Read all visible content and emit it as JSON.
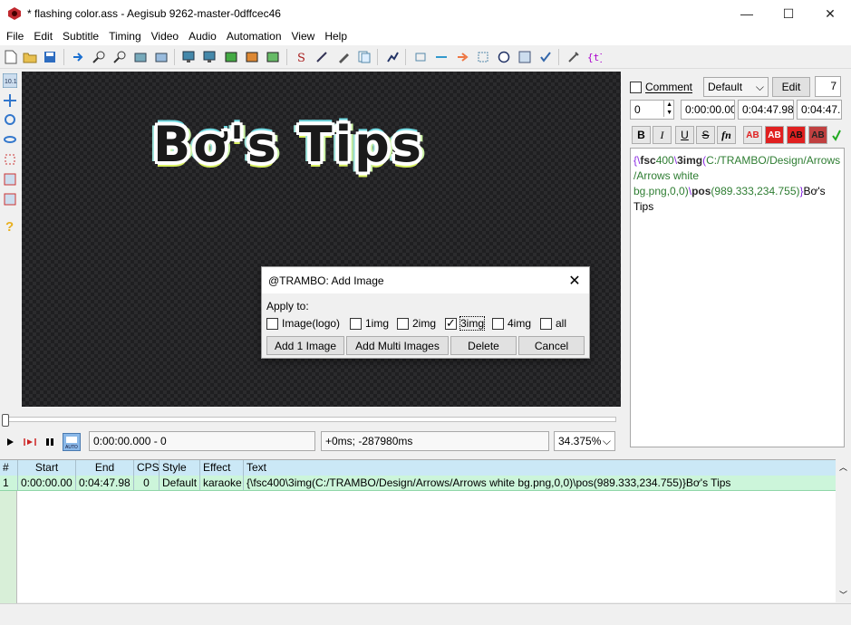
{
  "window": {
    "title": "* flashing color.ass - Aegisub 9262-master-0dffcec46",
    "minimize": "—",
    "maximize": "☐",
    "close": "✕"
  },
  "menu": [
    "File",
    "Edit",
    "Subtitle",
    "Timing",
    "Video",
    "Audio",
    "Automation",
    "View",
    "Help"
  ],
  "video": {
    "subtitle_render": "Bơ's Tips"
  },
  "dialog": {
    "title": "@TRAMBO: Add Image",
    "close": "✕",
    "apply_label": "Apply to:",
    "checkboxes": [
      {
        "label": "Image(logo)",
        "checked": false
      },
      {
        "label": "1img",
        "checked": false
      },
      {
        "label": "2img",
        "checked": false
      },
      {
        "label": "3img",
        "checked": true
      },
      {
        "label": "4img",
        "checked": false
      },
      {
        "label": "all",
        "checked": false
      }
    ],
    "buttons": [
      "Add 1 Image",
      "Add Multi Images",
      "Delete",
      "Cancel"
    ]
  },
  "playback": {
    "time_display": "0:00:00.000 - 0",
    "offset_display": "+0ms; -287980ms",
    "zoom": "34.375%"
  },
  "edit_panel": {
    "comment_label": "Comment",
    "style": "Default",
    "edit_button": "Edit",
    "layer_right": "7",
    "layer": "0",
    "start": "0:00:00.00",
    "end": "0:04:47.98",
    "duration": "0:04:47.",
    "format_buttons": [
      "B",
      "I",
      "U",
      "S",
      "fn",
      "AB",
      "AB",
      "AB",
      "AB"
    ],
    "text_parts": [
      {
        "t": "{\\",
        "c": "#8a2be2"
      },
      {
        "t": "fsc",
        "c": "#2a2a2a",
        "b": true
      },
      {
        "t": "400",
        "c": "#2e7d32"
      },
      {
        "t": "\\",
        "c": "#8a2be2"
      },
      {
        "t": "3img",
        "c": "#2a2a2a",
        "b": true
      },
      {
        "t": "(",
        "c": "#8a2be2"
      },
      {
        "t": "C:/TRAMBO/Design/Arrows/Arrows white bg.png,0,0)",
        "c": "#2e7d32"
      },
      {
        "t": "\\",
        "c": "#8a2be2"
      },
      {
        "t": "pos",
        "c": "#2a2a2a",
        "b": true
      },
      {
        "t": "(989.333,",
        "c": "#2e7d32"
      },
      {
        "t": "234.755)",
        "c": "#2e7d32"
      },
      {
        "t": "}",
        "c": "#8a2be2"
      },
      {
        "t": "Bơ's Tips",
        "c": "#000000"
      }
    ]
  },
  "grid": {
    "headers": [
      "#",
      "Start",
      "End",
      "CPS",
      "Style",
      "Effect",
      "Text"
    ],
    "rows": [
      [
        "1",
        "0:00:00.00",
        "0:04:47.98",
        "0",
        "Default",
        "karaoke",
        "{\\fsc400\\3img(C:/TRAMBO/Design/Arrows/Arrows white bg.png,0,0)\\pos(989.333,234.755)}Bơ's Tips"
      ]
    ]
  },
  "colors": {
    "grid_header": "#cbe8f6",
    "grid_selected_row": "#ccf5da",
    "video_bg": "#1f1f21"
  }
}
